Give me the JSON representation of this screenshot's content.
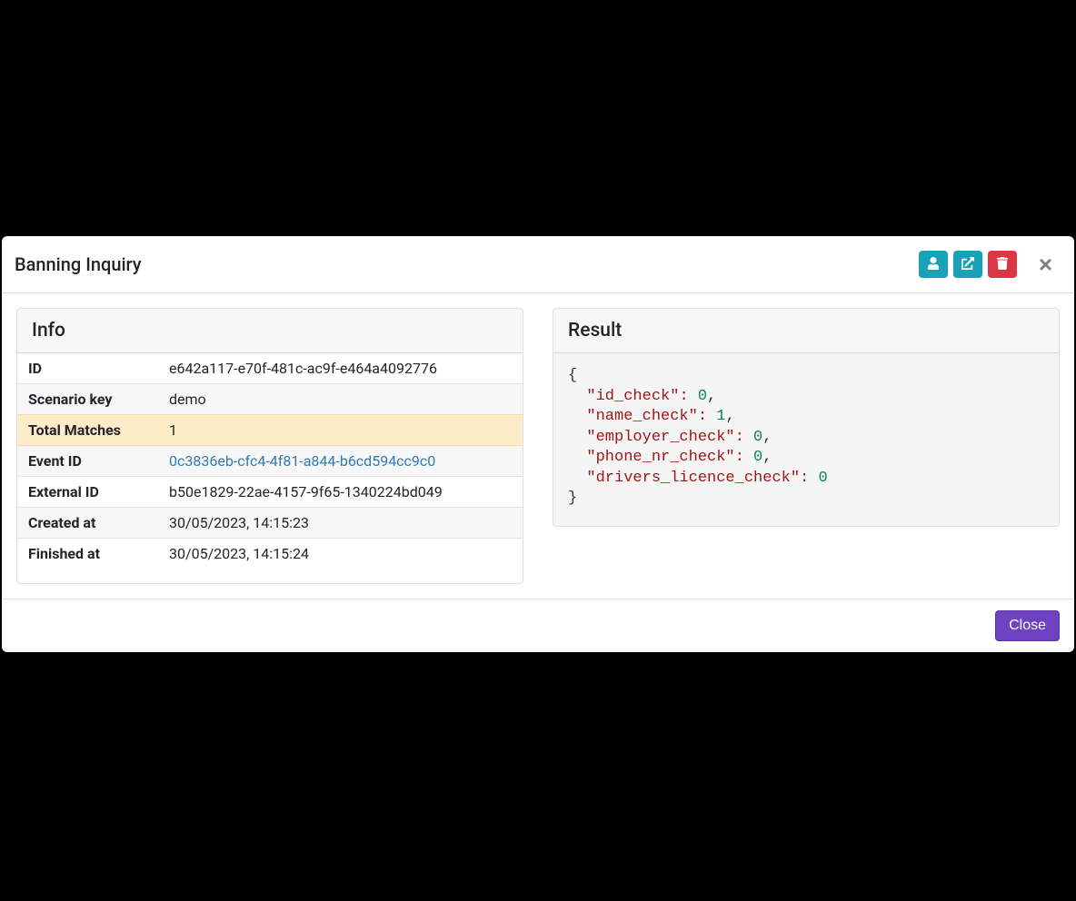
{
  "modal": {
    "title": "Banning Inquiry"
  },
  "info": {
    "header": "Info",
    "rows": [
      {
        "label": "ID",
        "value": "e642a117-e70f-481c-ac9f-e464a4092776",
        "link": false,
        "highlight": false
      },
      {
        "label": "Scenario key",
        "value": "demo",
        "link": false,
        "highlight": false
      },
      {
        "label": "Total Matches",
        "value": "1",
        "link": false,
        "highlight": true
      },
      {
        "label": "Event ID",
        "value": "0c3836eb-cfc4-4f81-a844-b6cd594cc9c0",
        "link": true,
        "highlight": false
      },
      {
        "label": "External ID",
        "value": "b50e1829-22ae-4157-9f65-1340224bd049",
        "link": false,
        "highlight": false
      },
      {
        "label": "Created at",
        "value": "30/05/2023, 14:15:23",
        "link": false,
        "highlight": false
      },
      {
        "label": "Finished at",
        "value": "30/05/2023, 14:15:24",
        "link": false,
        "highlight": false
      }
    ]
  },
  "result": {
    "header": "Result",
    "json": {
      "id_check": 0,
      "name_check": 1,
      "employer_check": 0,
      "phone_nr_check": 0,
      "drivers_licence_check": 0
    }
  },
  "footer": {
    "close_label": "Close"
  }
}
